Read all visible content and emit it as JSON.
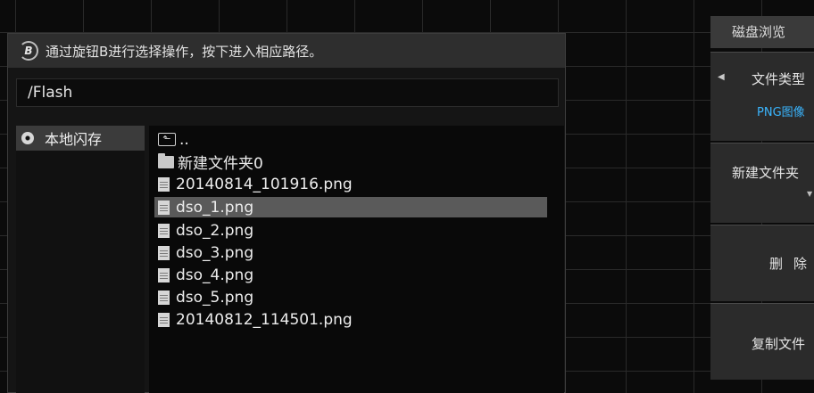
{
  "hint": {
    "knob_letter": "B",
    "text": "通过旋钮B进行选择操作，按下进入相应路径。"
  },
  "path": "/Flash",
  "location": {
    "label": "本地闪存",
    "icon": "disk-icon"
  },
  "files": [
    {
      "name": "..",
      "icon": "folder-up-icon"
    },
    {
      "name": "新建文件夹0",
      "icon": "folder-icon"
    },
    {
      "name": "20140814_101916.png",
      "icon": "file-icon"
    },
    {
      "name": "dso_1.png",
      "icon": "file-icon",
      "selected": true
    },
    {
      "name": "dso_2.png",
      "icon": "file-icon"
    },
    {
      "name": "dso_3.png",
      "icon": "file-icon"
    },
    {
      "name": "dso_4.png",
      "icon": "file-icon"
    },
    {
      "name": "dso_5.png",
      "icon": "file-icon"
    },
    {
      "name": "20140812_114501.png",
      "icon": "file-icon"
    }
  ],
  "side_menu": {
    "title": "磁盘浏览",
    "file_type": {
      "label": "文件类型",
      "value": "PNG图像"
    },
    "new_folder": {
      "label": "新建文件夹",
      "sub": "▼"
    },
    "delete": {
      "label": "删除"
    },
    "copy": {
      "label": "复制文件"
    }
  },
  "colors": {
    "accent": "#3ab6ff",
    "selection": "#5a5a5a"
  }
}
